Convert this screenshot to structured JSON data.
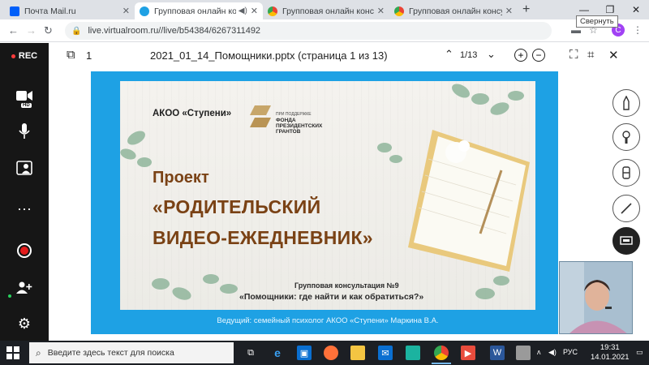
{
  "browser": {
    "tabs": [
      {
        "label": "Почта Mail.ru",
        "icon": "mail-icon",
        "active": false
      },
      {
        "label": "Групповая онлайн консу",
        "icon": "virtualroom-icon",
        "active": true
      },
      {
        "label": "Групповая онлайн консульт",
        "icon": "chrome-tab-icon",
        "active": false
      },
      {
        "label": "Групповая онлайн консульт",
        "icon": "chrome-tab-icon",
        "active": false
      }
    ],
    "tooltip": "Свернуть",
    "url": "live.virtualroom.ru//live/b54384/6267311492",
    "profile_initial": "C"
  },
  "sidebar": {
    "rec_label": "REC",
    "hd_badge": "HD",
    "items": [
      "video-camera-icon",
      "microphone-icon",
      "participants-icon",
      "more-icon",
      "record-button",
      "add-user-icon",
      "settings-icon"
    ]
  },
  "viewer": {
    "page_index": "1",
    "file_title": "2021_01_14_Помощники.pptx (страница 1 из 13)",
    "page_counter": "1/13"
  },
  "slide": {
    "org": "АКОО «Ступени»",
    "fund_small": "ПРИ ПОДДЕРЖКЕ",
    "fund_big": "ФОНДА\nПРЕЗИДЕНТСКИХ\nГРАНТОВ",
    "project": "Проект",
    "headline1": "«РОДИТЕЛЬСКИЙ",
    "headline2": "ВИДЕО-ЕЖЕДНЕВНИК»",
    "subtitle1": "Групповая консультация №9",
    "subtitle2": "«Помощники: где найти и как обратиться?»",
    "presenter": "Ведущий: семейный психолог АКОО «Ступени»  Маркина В.А."
  },
  "tools": [
    "pencil-tool-icon",
    "brush-tool-icon",
    "eraser-tool-icon",
    "line-tool-icon",
    "presentation-tool-icon"
  ],
  "taskbar": {
    "search_placeholder": "Введите здесь текст для поиска",
    "lang": "РУС",
    "time": "19:31",
    "date": "14.01.2021"
  },
  "colors": {
    "slide_border": "#1ea1e4",
    "title_brown": "#7a4215",
    "sidebar_bg": "#161616",
    "taskbar_bg": "#1c1f24"
  }
}
